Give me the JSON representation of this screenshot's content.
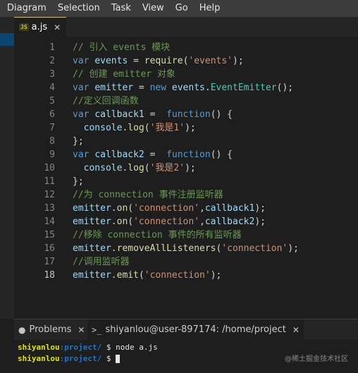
{
  "menu": [
    "Diagram",
    "Selection",
    "Task",
    "View",
    "Go",
    "Help"
  ],
  "tab": {
    "badge": "JS",
    "label": "a.js",
    "close": "✕"
  },
  "code_lines": [
    [
      [
        "c",
        "// 引入 events 模块"
      ]
    ],
    [
      [
        "k",
        "var"
      ],
      [
        "p",
        " "
      ],
      [
        "v",
        "events"
      ],
      [
        "p",
        " = "
      ],
      [
        "f",
        "require"
      ],
      [
        "p",
        "("
      ],
      [
        "s",
        "'events'"
      ],
      [
        "p",
        ");"
      ]
    ],
    [
      [
        "c",
        "// 创建 emitter 对象"
      ]
    ],
    [
      [
        "k",
        "var"
      ],
      [
        "p",
        " "
      ],
      [
        "v",
        "emitter"
      ],
      [
        "p",
        " = "
      ],
      [
        "k",
        "new"
      ],
      [
        "p",
        " "
      ],
      [
        "v",
        "events"
      ],
      [
        "p",
        "."
      ],
      [
        "t",
        "EventEmitter"
      ],
      [
        "p",
        "();"
      ]
    ],
    [
      [
        "c",
        "//定义回调函数"
      ]
    ],
    [
      [
        "k",
        "var"
      ],
      [
        "p",
        " "
      ],
      [
        "v",
        "callback1"
      ],
      [
        "p",
        " =  "
      ],
      [
        "k",
        "function"
      ],
      [
        "p",
        "() {"
      ]
    ],
    [
      [
        "p",
        "  "
      ],
      [
        "v",
        "console"
      ],
      [
        "p",
        "."
      ],
      [
        "f",
        "log"
      ],
      [
        "p",
        "("
      ],
      [
        "s",
        "'我是1'"
      ],
      [
        "p",
        ");"
      ]
    ],
    [
      [
        "p",
        "};"
      ]
    ],
    [
      [
        "k",
        "var"
      ],
      [
        "p",
        " "
      ],
      [
        "v",
        "callback2"
      ],
      [
        "p",
        " =  "
      ],
      [
        "k",
        "function"
      ],
      [
        "p",
        "() {"
      ]
    ],
    [
      [
        "p",
        "  "
      ],
      [
        "v",
        "console"
      ],
      [
        "p",
        "."
      ],
      [
        "f",
        "log"
      ],
      [
        "p",
        "("
      ],
      [
        "s",
        "'我是2'"
      ],
      [
        "p",
        ");"
      ]
    ],
    [
      [
        "p",
        "};"
      ]
    ],
    [
      [
        "c",
        "//为 connection 事件注册监听器"
      ]
    ],
    [
      [
        "v",
        "emitter"
      ],
      [
        "p",
        "."
      ],
      [
        "f",
        "on"
      ],
      [
        "p",
        "("
      ],
      [
        "s",
        "'connection'"
      ],
      [
        "p",
        ","
      ],
      [
        "v",
        "callback1"
      ],
      [
        "p",
        ");"
      ]
    ],
    [
      [
        "v",
        "emitter"
      ],
      [
        "p",
        "."
      ],
      [
        "f",
        "on"
      ],
      [
        "p",
        "("
      ],
      [
        "s",
        "'connection'"
      ],
      [
        "p",
        ","
      ],
      [
        "v",
        "callback2"
      ],
      [
        "p",
        ");"
      ]
    ],
    [
      [
        "c",
        "//移除 connection 事件的所有监听器"
      ]
    ],
    [
      [
        "v",
        "emitter"
      ],
      [
        "p",
        "."
      ],
      [
        "f",
        "removeAllListeners"
      ],
      [
        "p",
        "("
      ],
      [
        "s",
        "'connection'"
      ],
      [
        "p",
        ");"
      ]
    ],
    [
      [
        "c",
        "//调用监听器"
      ]
    ],
    [
      [
        "v",
        "emitter"
      ],
      [
        "p",
        "."
      ],
      [
        "f",
        "emit"
      ],
      [
        "p",
        "("
      ],
      [
        "s",
        "'connection'"
      ],
      [
        "p",
        ");"
      ]
    ]
  ],
  "active_line": 18,
  "panel": {
    "problems_label": "Problems",
    "problems_icon": "circle-info-icon",
    "terminal_label": "shiyanlou@user-897174: /home/project",
    "terminal_icon": "terminal-prompt-icon",
    "close": "✕"
  },
  "terminal": {
    "user": "shiyanlou",
    "path": ":project/",
    "prompt": " $ ",
    "command": "node a.js"
  },
  "watermark": "@稀土掘金技术社区",
  "colors": {
    "tab_accent": "#d7ba7d",
    "selection": "#094771"
  }
}
